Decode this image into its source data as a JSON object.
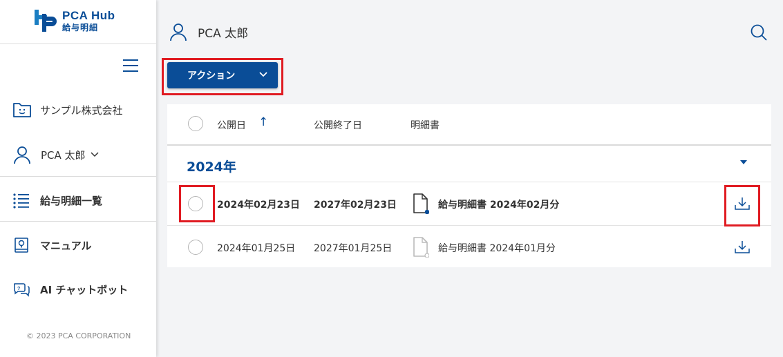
{
  "app": {
    "title": "PCA Hub",
    "subtitle": "給与明細"
  },
  "sidebar": {
    "company": "サンプル株式会社",
    "user": "PCA 太郎",
    "items": [
      {
        "label": "給与明細一覧",
        "icon": "list-icon"
      },
      {
        "label": "マニュアル",
        "icon": "manual-icon"
      },
      {
        "label": "AI チャットボット",
        "icon": "chatbot-icon"
      }
    ],
    "copyright": "© 2023 PCA CORPORATION"
  },
  "header": {
    "user_name": "PCA 太郎"
  },
  "toolbar": {
    "action_label": "アクション"
  },
  "table": {
    "columns": [
      "公開日",
      "公開終了日",
      "明細書"
    ],
    "sort_indicator": "↑",
    "group_label": "2024年",
    "rows": [
      {
        "published": "2024年02月23日",
        "end": "2027年02月23日",
        "document": "給与明細書 2024年02月分",
        "unread": true
      },
      {
        "published": "2024年01月25日",
        "end": "2027年01月25日",
        "document": "給与明細書 2024年01月分",
        "unread": false
      }
    ]
  },
  "colors": {
    "brand": "#0a4d97",
    "highlight": "#e01b22"
  }
}
